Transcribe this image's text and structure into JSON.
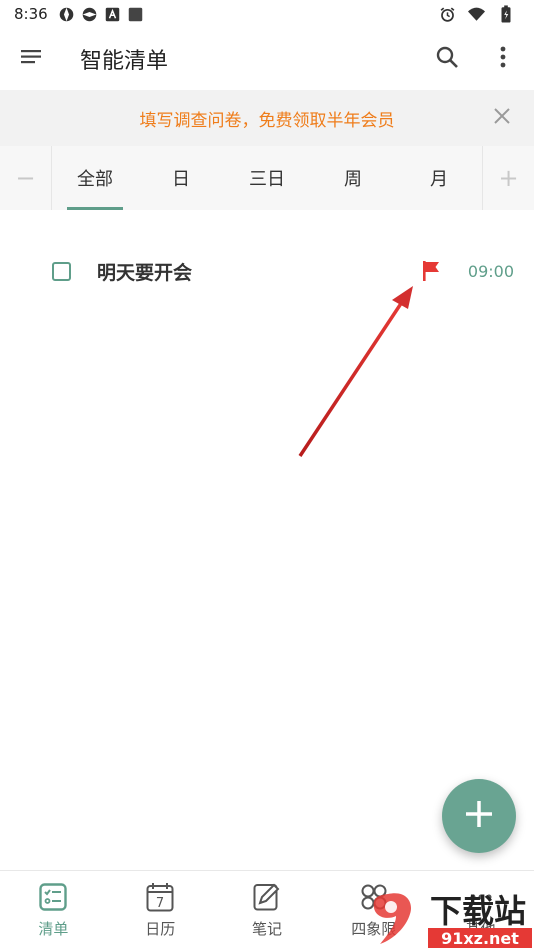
{
  "status_bar": {
    "time": "8:36",
    "icons": [
      "aperture-icon",
      "aperture-icon",
      "a-icon",
      "square-icon"
    ],
    "right_icons": [
      "alarm-icon",
      "wifi-icon",
      "battery-icon"
    ]
  },
  "app_bar": {
    "title": "智能清单",
    "icons": [
      "menu-icon",
      "search-icon",
      "more-vert-icon"
    ]
  },
  "banner": {
    "text": "填写调查问卷，免费领取半年会员",
    "text_color": "#ef7d1b"
  },
  "tabs": {
    "minus": "−",
    "plus": "+",
    "items": [
      "全部",
      "日",
      "三日",
      "周",
      "月"
    ],
    "active_index": 0,
    "accent": "#5f9e8a"
  },
  "task": {
    "title": "明天要开会",
    "time": "09:00",
    "flag_color": "#e53935",
    "checked": false
  },
  "fab": {
    "icon": "plus-icon",
    "color": "#69a492"
  },
  "bottom_nav": {
    "items": [
      {
        "label": "清单",
        "icon": "checklist-icon",
        "active": true
      },
      {
        "label": "日历",
        "icon": "calendar-icon",
        "day": "7",
        "active": false
      },
      {
        "label": "笔记",
        "icon": "note-edit-icon",
        "active": false
      },
      {
        "label": "四象限",
        "icon": "quadrant-icon",
        "active": false
      },
      {
        "label": "其他",
        "icon": "more-icon",
        "active": false
      }
    ]
  },
  "watermark": {
    "main": "下载站",
    "site": "91xz.net"
  }
}
